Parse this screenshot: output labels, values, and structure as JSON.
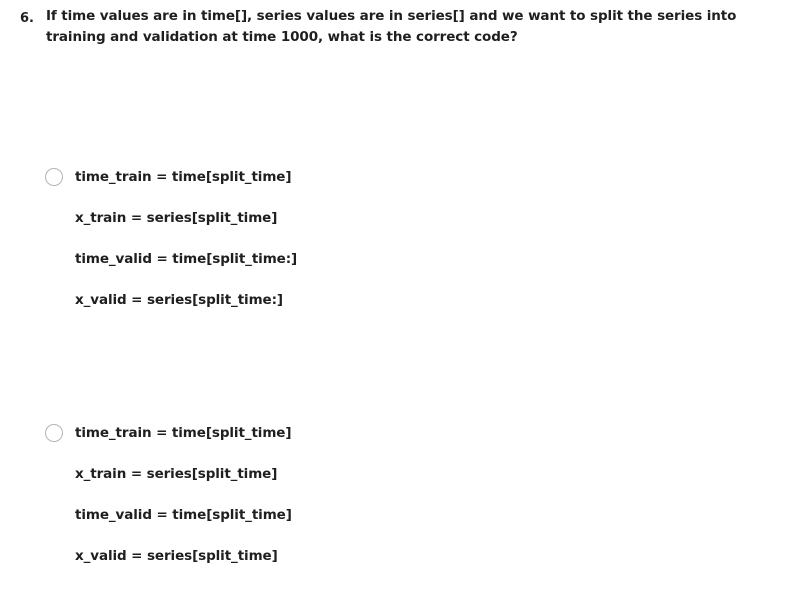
{
  "question": {
    "number": "6.",
    "text": "If time values are in time[], series values are in series[] and we want to split the series into training and validation at time 1000, what is the correct code?"
  },
  "options": [
    {
      "lines": [
        "time_train = time[split_time]",
        "x_train = series[split_time]",
        "time_valid = time[split_time:]",
        "x_valid = series[split_time:]"
      ]
    },
    {
      "lines": [
        "time_train = time[split_time]",
        "x_train = series[split_time]",
        "time_valid = time[split_time]",
        "x_valid = series[split_time]"
      ]
    }
  ],
  "colors": {
    "text": "#1f1f1f",
    "radio_border": "#b5b5b5"
  }
}
